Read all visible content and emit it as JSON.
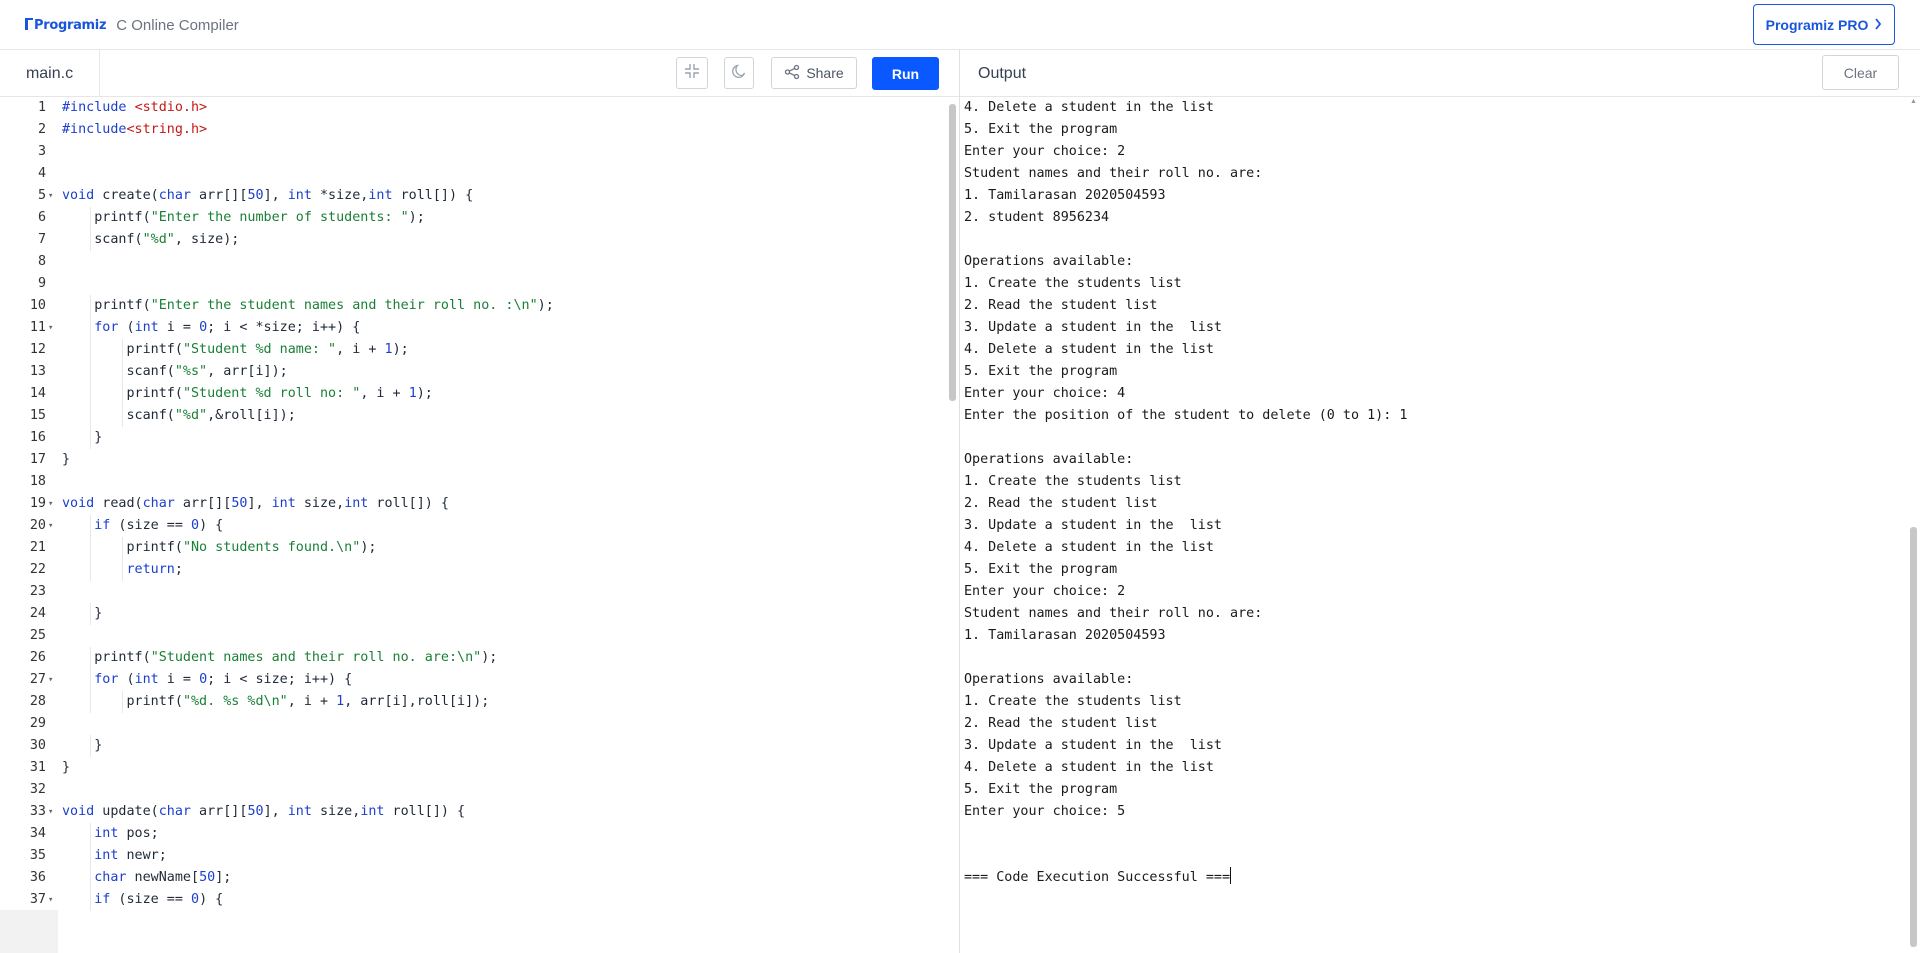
{
  "header": {
    "logo_text": "Programiz",
    "product": "C Online Compiler",
    "pro_button": "Programiz PRO"
  },
  "editor": {
    "file_tab": "main.c",
    "share_label": "Share",
    "run_label": "Run",
    "lines": [
      {
        "n": "1",
        "fold": false,
        "html": "<span style=\"color:#1c3fce\">#include</span> <span style=\"color:#c41a16\">&lt;stdio.h&gt;</span>"
      },
      {
        "n": "2",
        "fold": false,
        "html": "<span style=\"color:#1c3fce\">#include</span><span style=\"color:#c41a16\">&lt;string.h&gt;</span>"
      },
      {
        "n": "3",
        "fold": false,
        "html": ""
      },
      {
        "n": "4",
        "fold": false,
        "html": ""
      },
      {
        "n": "5",
        "fold": true,
        "html": "<span style=\"color:#1c3fce\">void</span> create(<span style=\"color:#1c3fce\">char</span> arr[][<span style=\"color:#1c3fce\">50</span>], <span style=\"color:#1c3fce\">int</span> *size,<span style=\"color:#1c3fce\">int</span> roll[]) {"
      },
      {
        "n": "6",
        "fold": false,
        "html": "    printf(<span style=\"color:#1a7f37\">\"Enter the number of students: \"</span>);"
      },
      {
        "n": "7",
        "fold": false,
        "html": "    scanf(<span style=\"color:#1a7f37\">\"%d\"</span>, size);"
      },
      {
        "n": "8",
        "fold": false,
        "html": ""
      },
      {
        "n": "9",
        "fold": false,
        "html": ""
      },
      {
        "n": "10",
        "fold": false,
        "html": "    printf(<span style=\"color:#1a7f37\">\"Enter the student names and their roll no. :\\n\"</span>);"
      },
      {
        "n": "11",
        "fold": true,
        "html": "    <span style=\"color:#1c3fce\">for</span> (<span style=\"color:#1c3fce\">int</span> i = <span style=\"color:#1c3fce\">0</span>; i &lt; *size; i++) {"
      },
      {
        "n": "12",
        "fold": false,
        "html": "        printf(<span style=\"color:#1a7f37\">\"Student %d name: \"</span>, i + <span style=\"color:#1c3fce\">1</span>);"
      },
      {
        "n": "13",
        "fold": false,
        "html": "        scanf(<span style=\"color:#1a7f37\">\"%s\"</span>, arr[i]);"
      },
      {
        "n": "14",
        "fold": false,
        "html": "        printf(<span style=\"color:#1a7f37\">\"Student %d roll no: \"</span>, i + <span style=\"color:#1c3fce\">1</span>);"
      },
      {
        "n": "15",
        "fold": false,
        "html": "        scanf(<span style=\"color:#1a7f37\">\"%d\"</span>,&amp;roll[i]);"
      },
      {
        "n": "16",
        "fold": false,
        "html": "    }"
      },
      {
        "n": "17",
        "fold": false,
        "html": "}"
      },
      {
        "n": "18",
        "fold": false,
        "html": ""
      },
      {
        "n": "19",
        "fold": true,
        "html": "<span style=\"color:#1c3fce\">void</span> read(<span style=\"color:#1c3fce\">char</span> arr[][<span style=\"color:#1c3fce\">50</span>], <span style=\"color:#1c3fce\">int</span> size,<span style=\"color:#1c3fce\">int</span> roll[]) {"
      },
      {
        "n": "20",
        "fold": true,
        "html": "    <span style=\"color:#1c3fce\">if</span> (size == <span style=\"color:#1c3fce\">0</span>) {"
      },
      {
        "n": "21",
        "fold": false,
        "html": "        printf(<span style=\"color:#1a7f37\">\"No students found.\\n\"</span>);"
      },
      {
        "n": "22",
        "fold": false,
        "html": "        <span style=\"color:#1c3fce\">return</span>;"
      },
      {
        "n": "23",
        "fold": false,
        "html": ""
      },
      {
        "n": "24",
        "fold": false,
        "html": "    }"
      },
      {
        "n": "25",
        "fold": false,
        "html": ""
      },
      {
        "n": "26",
        "fold": false,
        "html": "    printf(<span style=\"color:#1a7f37\">\"Student names and their roll no. are:\\n\"</span>);"
      },
      {
        "n": "27",
        "fold": true,
        "html": "    <span style=\"color:#1c3fce\">for</span> (<span style=\"color:#1c3fce\">int</span> i = <span style=\"color:#1c3fce\">0</span>; i &lt; size; i++) {"
      },
      {
        "n": "28",
        "fold": false,
        "html": "        printf(<span style=\"color:#1a7f37\">\"%d. %s %d\\n\"</span>, i + <span style=\"color:#1c3fce\">1</span>, arr[i],roll[i]);"
      },
      {
        "n": "29",
        "fold": false,
        "html": ""
      },
      {
        "n": "30",
        "fold": false,
        "html": "    }"
      },
      {
        "n": "31",
        "fold": false,
        "html": "}"
      },
      {
        "n": "32",
        "fold": false,
        "html": ""
      },
      {
        "n": "33",
        "fold": true,
        "html": "<span style=\"color:#1c3fce\">void</span> update(<span style=\"color:#1c3fce\">char</span> arr[][<span style=\"color:#1c3fce\">50</span>], <span style=\"color:#1c3fce\">int</span> size,<span style=\"color:#1c3fce\">int</span> roll[]) {"
      },
      {
        "n": "34",
        "fold": false,
        "html": "    <span style=\"color:#1c3fce\">int</span> pos;"
      },
      {
        "n": "35",
        "fold": false,
        "html": "    <span style=\"color:#1c3fce\">int</span> newr;"
      },
      {
        "n": "36",
        "fold": false,
        "html": "    <span style=\"color:#1c3fce\">char</span> newName[<span style=\"color:#1c3fce\">50</span>];"
      },
      {
        "n": "37",
        "fold": true,
        "html": "    <span style=\"color:#1c3fce\">if</span> (size == <span style=\"color:#1c3fce\">0</span>) {"
      }
    ]
  },
  "output": {
    "title": "Output",
    "clear_label": "Clear",
    "lines": [
      "4. Delete a student in the list",
      "5. Exit the program",
      "Enter your choice: 2",
      "Student names and their roll no. are:",
      "1. Tamilarasan 2020504593",
      "2. student 8956234",
      "",
      "Operations available:",
      "1. Create the students list",
      "2. Read the student list",
      "3. Update a student in the  list",
      "4. Delete a student in the list",
      "5. Exit the program",
      "Enter your choice: 4",
      "Enter the position of the student to delete (0 to 1): 1",
      "",
      "Operations available:",
      "1. Create the students list",
      "2. Read the student list",
      "3. Update a student in the  list",
      "4. Delete a student in the list",
      "5. Exit the program",
      "Enter your choice: 2",
      "Student names and their roll no. are:",
      "1. Tamilarasan 2020504593",
      "",
      "Operations available:",
      "1. Create the students list",
      "2. Read the student list",
      "3. Update a student in the  list",
      "4. Delete a student in the list",
      "5. Exit the program",
      "Enter your choice: 5",
      "",
      "",
      "=== Code Execution Successful ==="
    ]
  },
  "colors": {
    "accent": "#0a58ff",
    "keyword": "#1c3fce",
    "string": "#1a7f37",
    "include": "#c41a16"
  }
}
